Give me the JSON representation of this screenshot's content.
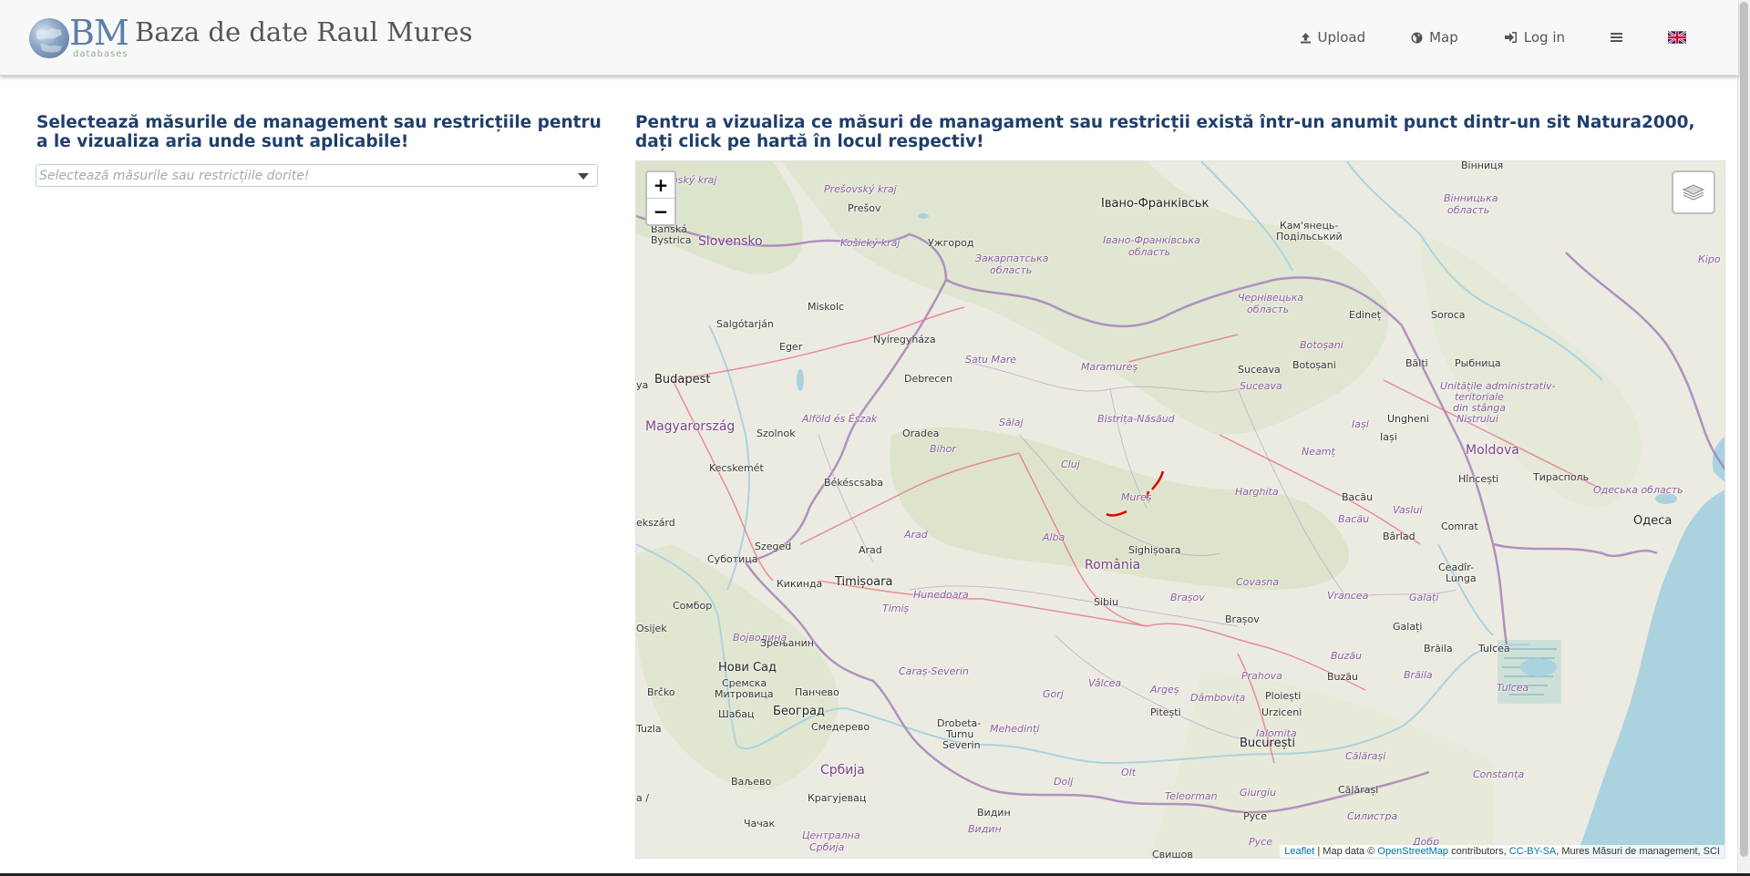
{
  "navbar": {
    "logo_text": "BM",
    "logo_subtext": "databases",
    "title": "Baza de date Raul Mures",
    "items": [
      {
        "label": "Upload",
        "icon": "upload-icon"
      },
      {
        "label": "Map",
        "icon": "globe-icon"
      },
      {
        "label": "Log in",
        "icon": "sign-in-icon"
      }
    ],
    "menu_icon": "hamburger-icon",
    "language_flag": "uk-flag-icon"
  },
  "left_panel": {
    "heading": "Selectează măsurile de management sau restricțiile pentru a le vizualiza aria unde sunt aplicabile!",
    "select_placeholder": "Selectează măsurile sau restricțiile dorite!"
  },
  "right_panel": {
    "heading": "Pentru a vizualiza ce măsuri de managament sau restricții există într-un anumit punct dintr-un sit Natura2000, dați click pe hartă în locul respectiv!"
  },
  "map": {
    "zoom_in": "+",
    "zoom_out": "−",
    "layers_icon": "layers-icon",
    "attribution": {
      "leaflet": "Leaflet",
      "sep1": " | Map data © ",
      "osm": "OpenStreetMap",
      "contrib": " contributors, ",
      "license": "CC-BY-SA",
      "layers": ", Mures Măsuri de management, SCI"
    },
    "labels": {
      "vinnytsia": "Вінниця",
      "vinnytska_obl": "Вінницька",
      "vinnytska_obl2": "область",
      "ivano": "Івано-Франківськ",
      "ivano_obl": "Івано-Франківська",
      "ivano_obl2": "область",
      "kamianets": "Кам'янець-",
      "kamianets2": "Подільський",
      "presovsky": "Prešovský kraj",
      "presov": "Prešov",
      "kosicky": "Košický kraj",
      "uzhhorod": "Ужгород",
      "zakarpatska": "Закарпатська",
      "zakarpatska2": "область",
      "zilinsky": "Žilinský kraj",
      "banska": "Banská",
      "banska2": "Bystrica",
      "slovensko": "Slovensko",
      "chernivetska": "Чернівецька",
      "chernivetska2": "область",
      "edinet": "Edineț",
      "soroca": "Soroca",
      "miskolc": "Miskolc",
      "salgotarjan": "Salgótarján",
      "nyiregyhaza": "Nyíregyháza",
      "eger": "Eger",
      "satu_mare": "Satu Mare",
      "maramures": "Maramureș",
      "suceava": "Suceava",
      "suceava_reg": "Suceava",
      "botosani": "Botoșani",
      "botosani_reg": "Botoșani",
      "balti": "Bălți",
      "rybnitsa": "Рыбница",
      "unitatile": "Unitățile administrativ-",
      "unitatile2": "teritoriale",
      "unitatile3": "din stânga",
      "unitatile4": "Nistrului",
      "budapest": "Budapest",
      "debrecen": "Debrecen",
      "salaj": "Sălaj",
      "bistrita": "Bistrița-Năsăud",
      "ungheni": "Ungheni",
      "iasi": "Iași",
      "iasi_reg": "Iași",
      "magyarorszag": "Magyarország",
      "szolnok": "Szolnok",
      "alfold": "Alföld és Észak",
      "oradea": "Oradea",
      "bihor": "Bihor",
      "cluj": "Cluj",
      "neamt": "Neamț",
      "moldova": "Moldova",
      "kecskemet": "Kecskemét",
      "hincesti": "Hîncești",
      "tiraspol": "Тирасполь",
      "odeska": "Одеська область",
      "bekescsaba": "Békéscsaba",
      "harghita": "Harghita",
      "bacau": "Bacău",
      "bacau_reg": "Bacău",
      "mures": "Mureș",
      "vaslui": "Vaslui",
      "odesa": "Одеса",
      "kecskemet_w": "ekszárd",
      "arad_reg": "Arad",
      "comrat": "Comrat",
      "barlad": "Bârlad",
      "szeged": "Szeged",
      "arad": "Arad",
      "sighisoara": "Sighișoara",
      "subotica": "Суботица",
      "alba": "Alba",
      "romania": "România",
      "kikinda": "Кикинда",
      "timisoara": "Timișoara",
      "covasna": "Covasna",
      "vrancea": "Vrancea",
      "galati_reg": "Galați",
      "ceadir": "Ceadîr-",
      "ceadir2": "Lunga",
      "hunedoara": "Hunedoara",
      "sibiu": "Sibiu",
      "brasov_reg": "Brașov",
      "sombor": "Сомбор",
      "timis": "Timiș",
      "brasov": "Brașov",
      "galati": "Galați",
      "osijek": "Osijek",
      "vojvodina": "Војводина",
      "zrenjanin": "Зрењанин",
      "braila": "Brăila",
      "tulcea": "Tulcea",
      "novi_sad": "Нови Сад",
      "caras": "Caraș-Severin",
      "buzau_reg": "Buzău",
      "buzau": "Buzău",
      "braila_reg": "Brăila",
      "tulcea_reg": "Tulcea",
      "sremska": "Сремска",
      "sremska2": "Митровица",
      "pancevo": "Панчево",
      "gorj": "Gorj",
      "valcea": "Vâlcea",
      "arges": "Argeș",
      "prahova": "Prahova",
      "ploiesti": "Ploiești",
      "brcko": "Brčko",
      "dambovita": "Dâmbovița",
      "beograd": "Београд",
      "sabac": "Шабац",
      "pitesti": "Pitești",
      "urziceni": "Urziceni",
      "smederevo": "Смедерево",
      "drobeta": "Drobeta-",
      "drobeta2": "Turnu",
      "drobeta3": "Severin",
      "mehedinti": "Mehedinți",
      "tuzla": "Tuzla",
      "bucuresti": "București",
      "ialomita": "Ialomița",
      "srbija": "Србија",
      "calarasi_reg": "Călărași",
      "valjevo": "Ваљево",
      "constanta": "Constanța",
      "olt": "Olt",
      "dolj": "Dolj",
      "kragujevac": "Крагујевац",
      "calarasi": "Călărași",
      "giurgiu": "Giurgiu",
      "teleorman": "Teleorman",
      "cacak": "Чачак",
      "vidin": "Видин",
      "ruse": "Русе",
      "silistra": "Силистра",
      "centralna": "Централна",
      "centralna2": "Србија",
      "vidin_reg": "Видин",
      "ruse_reg": "Русе",
      "svishtov": "Свищов",
      "kirovohrad": "Кіро",
      "ya": "ya",
      "a_slash": "a /",
      "dobrich": "Добр"
    }
  }
}
